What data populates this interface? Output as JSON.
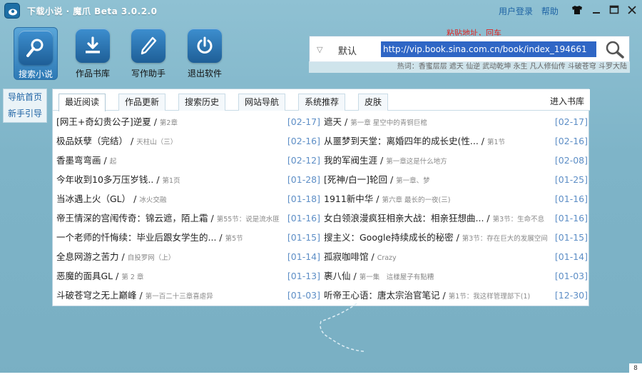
{
  "titlebar": {
    "title": "下载小说 · 魔爪 Beta 3.0.2.0",
    "links": [
      "用户登录",
      "帮助"
    ]
  },
  "toolbar": [
    {
      "label": "搜索小说",
      "icon": "search-icon",
      "active": true
    },
    {
      "label": "作品书库",
      "icon": "download-icon",
      "active": false
    },
    {
      "label": "写作助手",
      "icon": "pen-icon",
      "active": false
    },
    {
      "label": "退出软件",
      "icon": "power-icon",
      "active": false
    }
  ],
  "search": {
    "mode": "默认",
    "value": "http://vip.book.sina.com.cn/book/index_194661",
    "hotwords": "热词：香蜜层层 遮天 仙逆 武动乾坤 永生 凡人修仙传 斗破苍穹 斗罗大陆",
    "annotation": "粘贴地址，回车"
  },
  "sidenav": [
    "导航首页",
    "新手引导"
  ],
  "tabs": [
    "最近阅读",
    "作品更新",
    "搜索历史",
    "网站导航",
    "系统推荐",
    "皮肤"
  ],
  "goto_library": "进入书库",
  "left_items": [
    {
      "title": "[网王+奇幻贵公子]逆夏",
      "sub": "第2章",
      "date": "[02-17]"
    },
    {
      "title": "极品妖孽（完结）",
      "sub": "天柱山（三）",
      "date": "[02-16]"
    },
    {
      "title": "香墨弯弯画",
      "sub": "起",
      "date": "[02-12]"
    },
    {
      "title": "今年收到10多万压岁钱..",
      "sub": "第1页",
      "date": "[01-28]"
    },
    {
      "title": "当冰遇上火（GL）",
      "sub": "冰火交融",
      "date": "[01-18]"
    },
    {
      "title": "帝王情深的宫闱传奇：锦云遮，陌上霜",
      "sub": "第55节：说是流水匪",
      "date": "[01-16]"
    },
    {
      "title": "一个老师的忏悔续：毕业后跟女学生的...",
      "sub": "第5节",
      "date": "[01-15]"
    },
    {
      "title": "全息网游之苦力",
      "sub": "自投罗网（上）",
      "date": "[01-14]"
    },
    {
      "title": "恶魔的面具GL",
      "sub": "第 2 章",
      "date": "[01-13]"
    },
    {
      "title": "斗破苍穹之无上巅峰",
      "sub": "第一百二十三章喜虐异",
      "date": "[01-03]"
    }
  ],
  "right_items": [
    {
      "title": "遮天",
      "sub": "第一章 星空中的青铜巨棺",
      "date": "[02-17]"
    },
    {
      "title": "从噩梦到天堂：离婚四年的成长史(性...",
      "sub": "第1节",
      "date": "[02-16]"
    },
    {
      "title": "我的军阀生涯",
      "sub": "第一章这是什么地方",
      "date": "[02-08]"
    },
    {
      "title": "[死神/白一]轮回",
      "sub": "第一章、梦",
      "date": "[01-25]"
    },
    {
      "title": "1911新中华",
      "sub": "第六章 最长的一夜(三)",
      "date": "[01-16]"
    },
    {
      "title": "女白领浪漫疯狂相亲大战：相亲狂想曲...",
      "sub": "第3节：生命不息",
      "date": "[01-16]"
    },
    {
      "title": "搜主义：Google持续成长的秘密",
      "sub": "第3节：存在巨大的发展空间",
      "date": "[01-15]"
    },
    {
      "title": "孤寂咖啡馆",
      "sub": "Crazy",
      "date": "[01-14]"
    },
    {
      "title": "裹八仙",
      "sub": "第一集　這樣屋子有點糟",
      "date": "[01-03]"
    },
    {
      "title": "听帝王心语：唐太宗治官笔记",
      "sub": "第1节：我这样管理部下(1)",
      "date": "[12-30]"
    }
  ],
  "corner_label": "8",
  "colors": {
    "background": "#7fb3c6",
    "link": "#1e63a4",
    "date": "#5d8ec6",
    "url_highlight": "#2f66c5",
    "annotation": "#e0211f"
  }
}
